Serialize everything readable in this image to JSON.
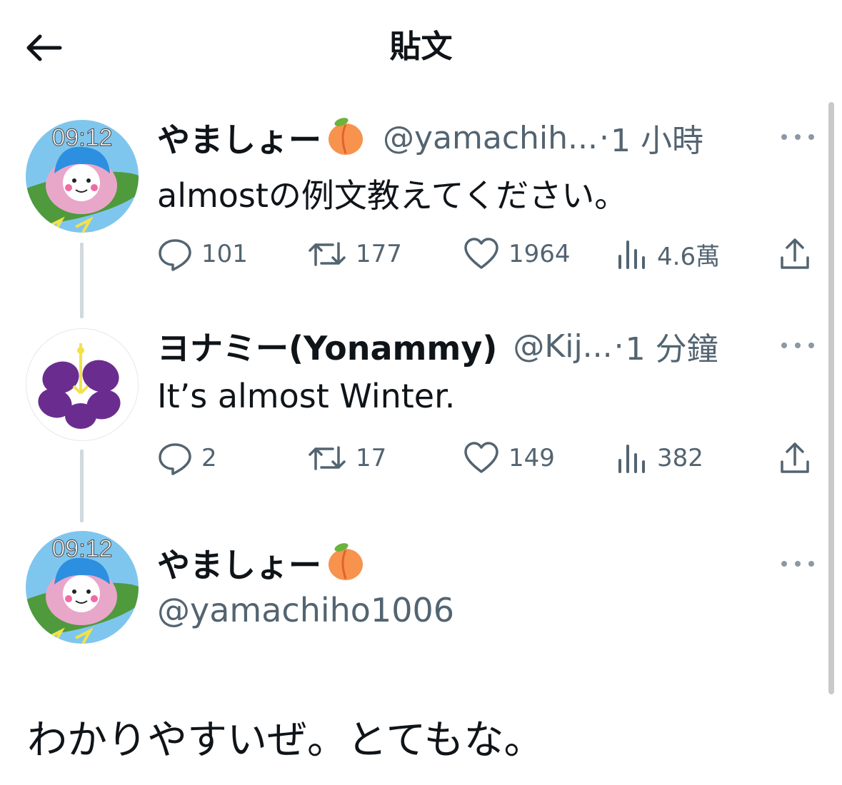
{
  "header": {
    "title": "貼文"
  },
  "tweets": [
    {
      "name": "やましょー",
      "handle": "@yamachih...",
      "separator": "·",
      "time": "1 小時",
      "text": "almostの例文教えてください。",
      "avatar_clock": "09:12",
      "stats": {
        "replies": "101",
        "retweets": "177",
        "likes": "1964",
        "views": "4.6萬"
      }
    },
    {
      "name": "ヨナミー(Yonammy)",
      "handle": "@Kij...",
      "separator": "·",
      "time": "1 分鐘",
      "text": "It’s almost Winter.",
      "stats": {
        "replies": "2",
        "retweets": "17",
        "likes": "149",
        "views": "382"
      }
    }
  ],
  "compose": {
    "name": "やましょー",
    "handle": "@yamachiho1006",
    "avatar_clock": "09:12",
    "text": "わかりやすいぜ。とてもな。"
  },
  "colors": {
    "text": "#0f1419",
    "secondary": "#536471",
    "thread_line": "#cfd9de"
  },
  "icons": [
    "back-arrow-icon",
    "peach-emoji-icon",
    "more-icon",
    "reply-icon",
    "retweet-icon",
    "like-icon",
    "views-icon",
    "share-icon"
  ]
}
